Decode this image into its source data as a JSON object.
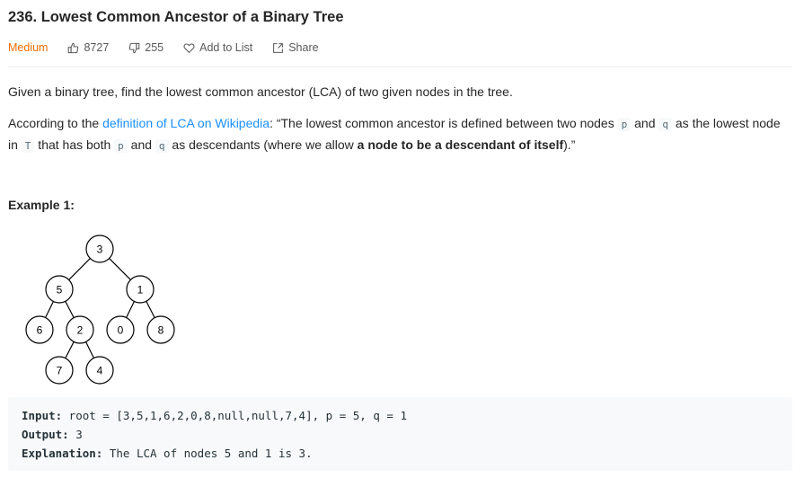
{
  "problem": {
    "title": "236. Lowest Common Ancestor of a Binary Tree",
    "difficulty": "Medium",
    "likes": "8727",
    "dislikes": "255",
    "add_to_list": "Add to List",
    "share": "Share",
    "colors": {
      "difficulty": "#ef6c00",
      "link": "#1a90ff"
    }
  },
  "description": {
    "p1": "Given a binary tree, find the lowest common ancestor (LCA) of two given nodes in the tree.",
    "p2_pre": "According to the ",
    "p2_link": "definition of LCA on Wikipedia",
    "p2_a": ": “The lowest common ancestor is defined between two nodes ",
    "code_p": "p",
    "p2_b": " and ",
    "code_q": "q",
    "p2_c": " as the lowest node in ",
    "code_T": "T",
    "p2_d": " that has both ",
    "p2_e": " and ",
    "p2_f": " as descendants (where we allow ",
    "p2_bold": "a node to be a descendant of itself",
    "p2_end": ").”"
  },
  "example1": {
    "title": "Example 1:",
    "tree_nodes": [
      "3",
      "5",
      "1",
      "6",
      "2",
      "0",
      "8",
      "7",
      "4"
    ],
    "input_label": "Input:",
    "input_value": " root = [3,5,1,6,2,0,8,null,null,7,4], p = 5, q = 1",
    "output_label": "Output:",
    "output_value": " 3",
    "explanation_label": "Explanation:",
    "explanation_value": " The LCA of nodes 5 and 1 is 3."
  }
}
